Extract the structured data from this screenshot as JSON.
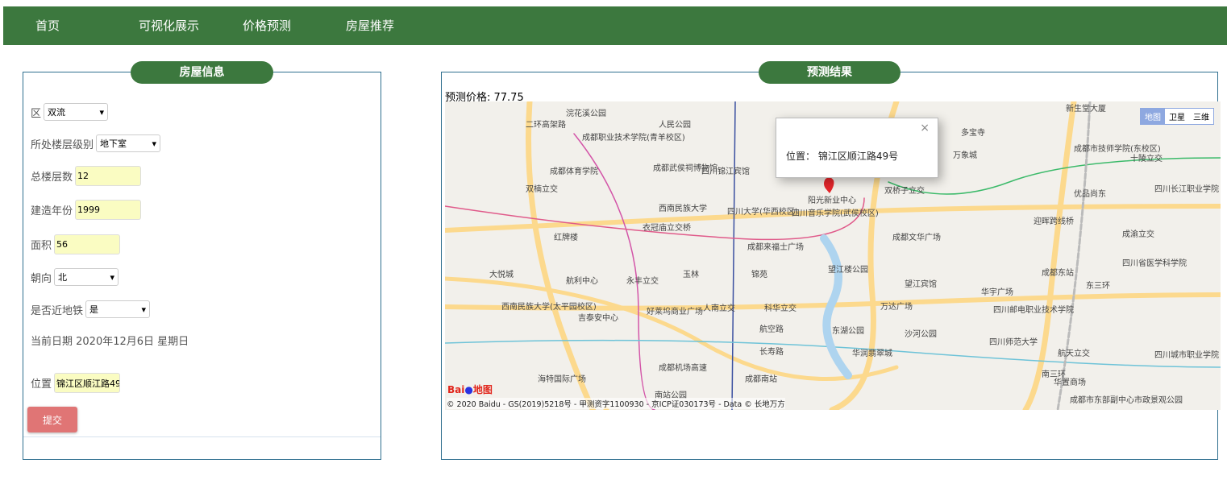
{
  "nav": {
    "items": [
      "首页",
      "可视化展示",
      "价格预测",
      "房屋推荐"
    ]
  },
  "form": {
    "title": "房屋信息",
    "district": {
      "label": "区",
      "value": "双流"
    },
    "floor_level": {
      "label": "所处楼层级别",
      "value": "地下室"
    },
    "total_floors": {
      "label": "总楼层数",
      "value": "12"
    },
    "build_year": {
      "label": "建造年份",
      "value": "1999"
    },
    "area": {
      "label": "面积",
      "value": "56"
    },
    "orientation": {
      "label": "朝向",
      "value": "北"
    },
    "near_subway": {
      "label": "是否近地铁",
      "value": "是"
    },
    "current_date": "当前日期 2020年12月6日 星期日",
    "location": {
      "label": "位置",
      "value": "锦江区顺江路49号"
    },
    "submit": "提交"
  },
  "result": {
    "title": "预测结果",
    "price_text": "预测价格: 77.75",
    "map": {
      "popup_label": "位置：",
      "popup_value": "锦江区顺江路49号",
      "close": "×",
      "types": [
        "地图",
        "卫星",
        "三维"
      ],
      "copyright": "© 2020 Baidu - GS(2019)5218号 - 甲测资字1100930 - 京ICP证030173号 - Data © 长地万方",
      "logo": "Bai地图",
      "labels": [
        "浣花溪公园",
        "人民公园",
        "成都职业技术学院(青羊校区)",
        "成都体育学院",
        "成都武侯祠博物馆",
        "四川锦江宾馆",
        "双楠立交",
        "西南民族大学",
        "四川大学(华西校区)",
        "四川音乐学院(武侯校区)",
        "阳光新业中心",
        "双桥子立交",
        "成都文华广场",
        "衣冠庙立交桥",
        "成都来福士广场",
        "红牌楼",
        "大悦城",
        "航利中心",
        "永丰立交",
        "玉林",
        "锦苑",
        "望江楼公园",
        "望江宾馆",
        "华宇广场",
        "成都东站",
        "四川省医学科学院",
        "好莱坞商业广场",
        "人南立交",
        "科华立交",
        "万达广场",
        "四川邮电职业技术学院",
        "西南民族大学(太平园校区)",
        "吉泰安中心",
        "航空路",
        "东湖公园",
        "沙河公园",
        "四川师范大学",
        "长寿路",
        "华润翡翠城",
        "航天立交",
        "成都机场高速",
        "成都南站",
        "南站公园",
        "海特国际广场",
        "华置商场",
        "四川城市职业学院",
        "成都市东部副中心市政景观公园",
        "万象城",
        "多宝寺",
        "新生堂大厦",
        "成都市技师学院(东校区)",
        "十陵立交",
        "优品尚东",
        "四川长江职业学院",
        "迎晖跨线桥",
        "成渝立交",
        "东三环",
        "南三环",
        "二环高架路"
      ]
    }
  }
}
